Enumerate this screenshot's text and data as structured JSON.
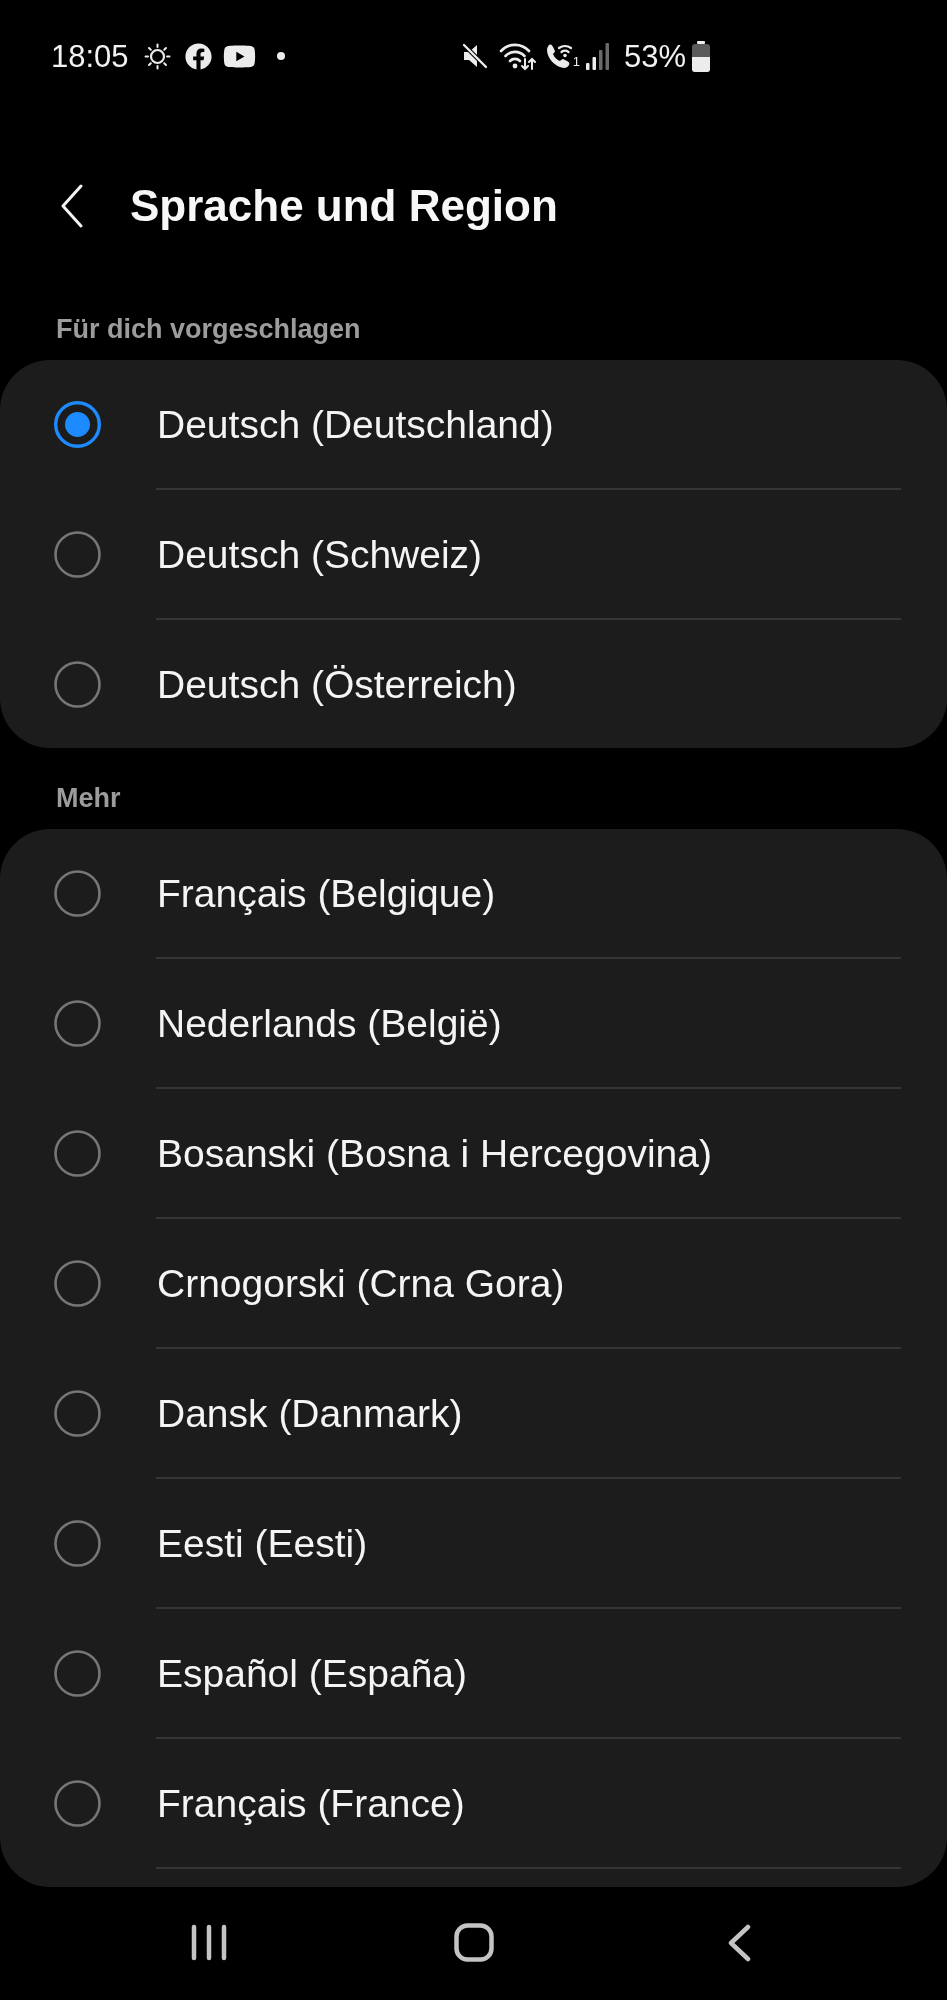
{
  "status_bar": {
    "time": "18:05",
    "sim_slot": "1",
    "battery": "53%"
  },
  "header": {
    "title": "Sprache und Region"
  },
  "sections": [
    {
      "title": "Für dich vorgeschlagen",
      "options": [
        {
          "label": "Deutsch (Deutschland)",
          "selected": true
        },
        {
          "label": "Deutsch (Schweiz)",
          "selected": false
        },
        {
          "label": "Deutsch (Österreich)",
          "selected": false
        }
      ]
    },
    {
      "title": "Mehr",
      "continues": true,
      "options": [
        {
          "label": "Français (Belgique)",
          "selected": false
        },
        {
          "label": "Nederlands (België)",
          "selected": false
        },
        {
          "label": "Bosanski (Bosna i Hercegovina)",
          "selected": false
        },
        {
          "label": "Crnogorski (Crna Gora)",
          "selected": false
        },
        {
          "label": "Dansk (Danmark)",
          "selected": false
        },
        {
          "label": "Eesti (Eesti)",
          "selected": false
        },
        {
          "label": "Español (España)",
          "selected": false
        },
        {
          "label": "Français (France)",
          "selected": false
        }
      ]
    }
  ]
}
